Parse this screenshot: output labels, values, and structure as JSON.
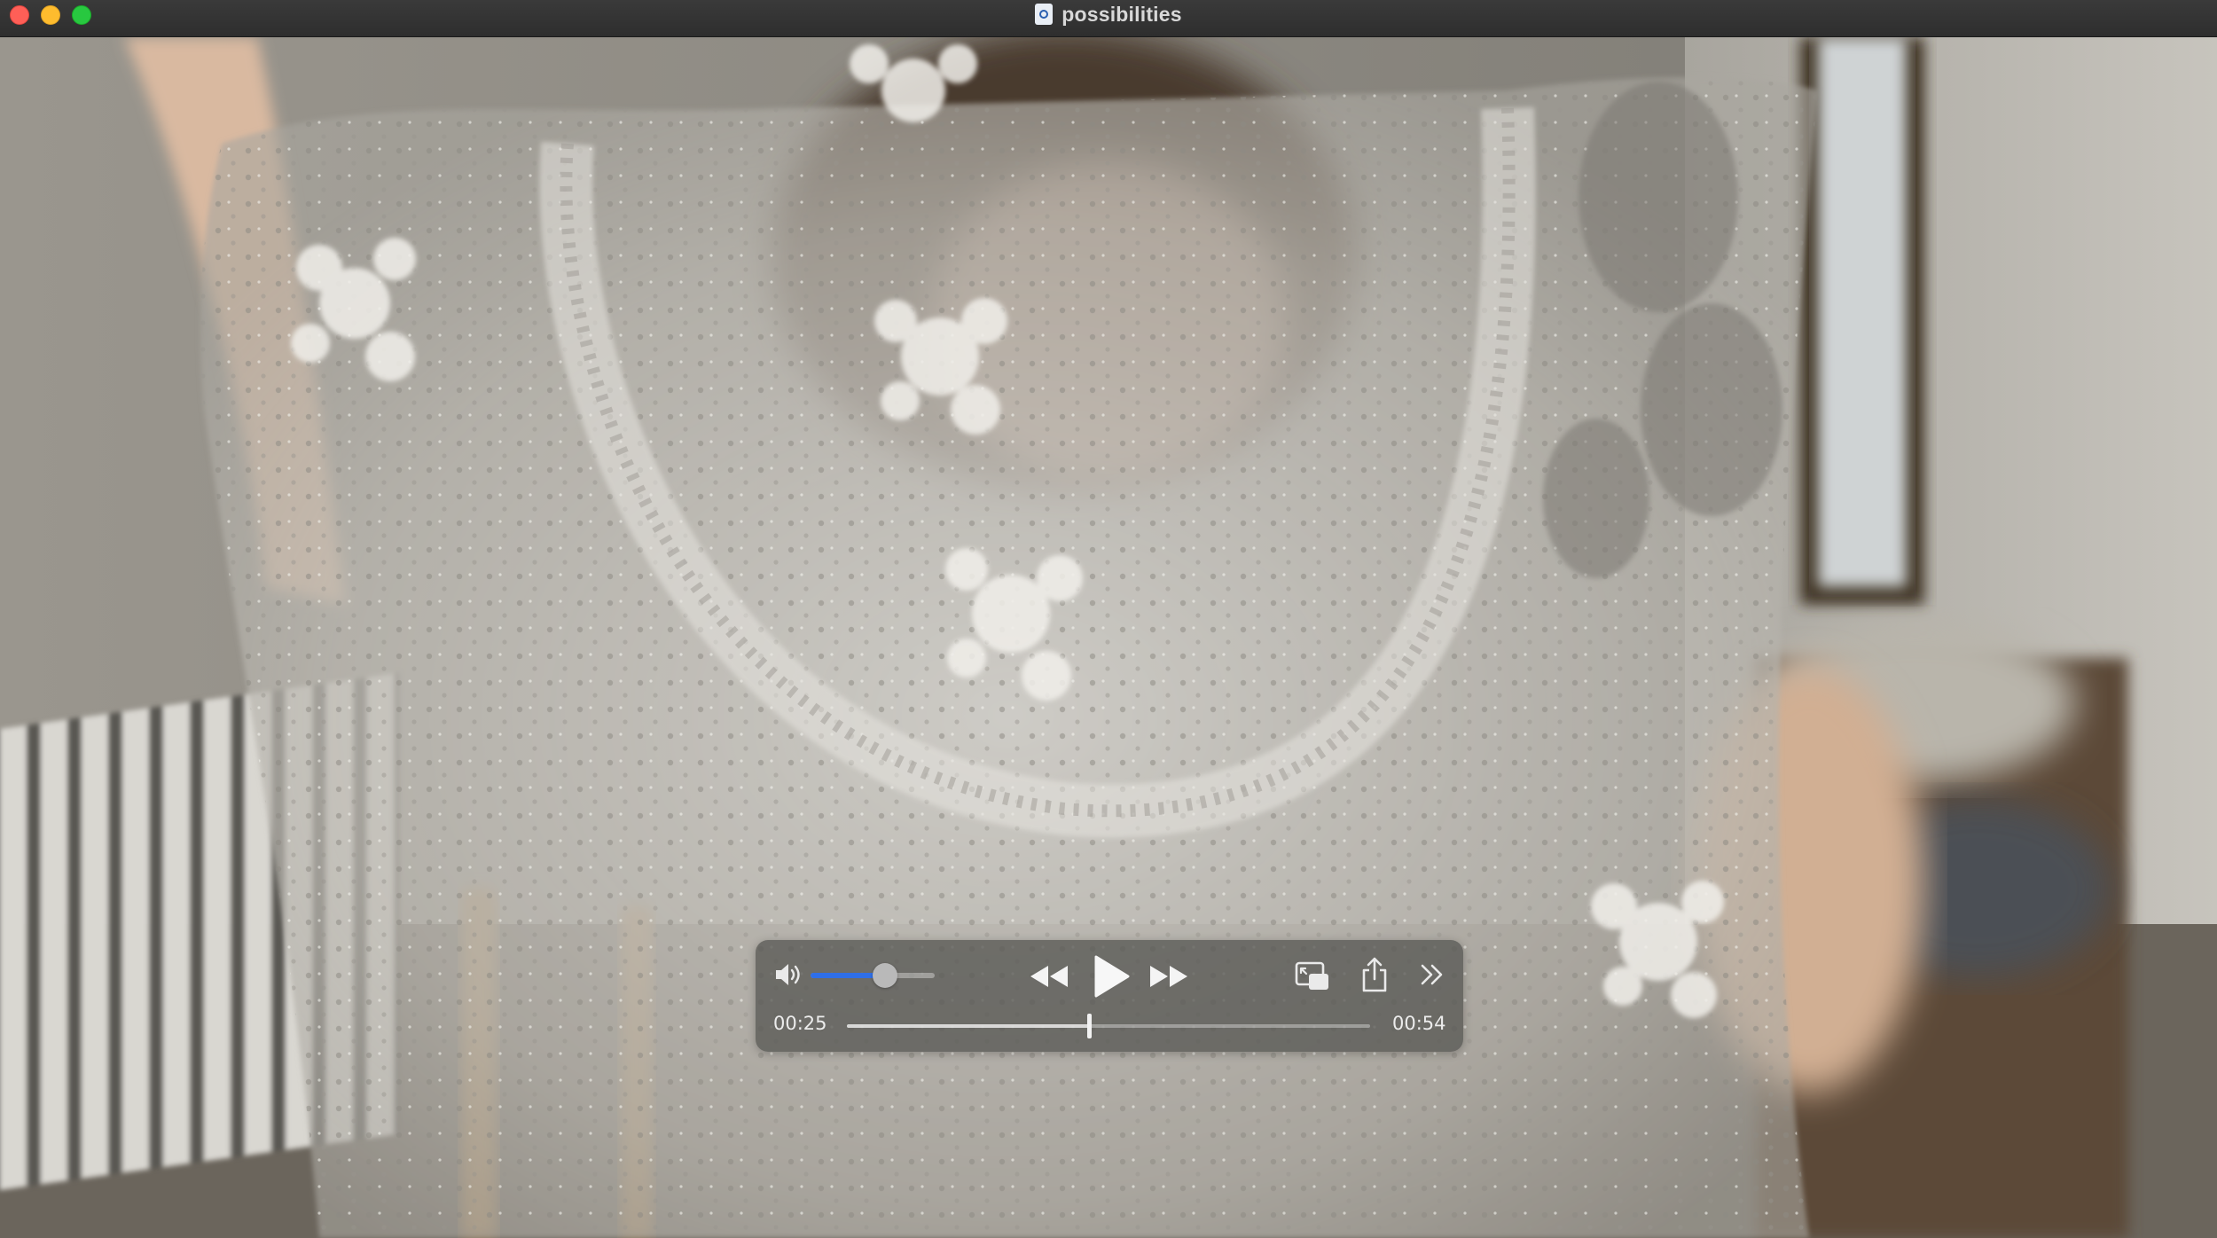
{
  "window": {
    "title": "possibilities",
    "title_icon": "quicktime-document-icon"
  },
  "player": {
    "volume_level": 0.6,
    "current_time": "00:25",
    "duration": "00:54",
    "progress_fraction": 0.463,
    "accent_color": "#2f6fe8",
    "icons": {
      "volume": "speaker-volume-icon",
      "rewind": "rewind-icon",
      "play": "play-icon",
      "fast_forward": "fast-forward-icon",
      "picture_in_picture": "picture-in-picture-icon",
      "share": "share-icon",
      "more": "chevron-double-right-icon"
    }
  }
}
